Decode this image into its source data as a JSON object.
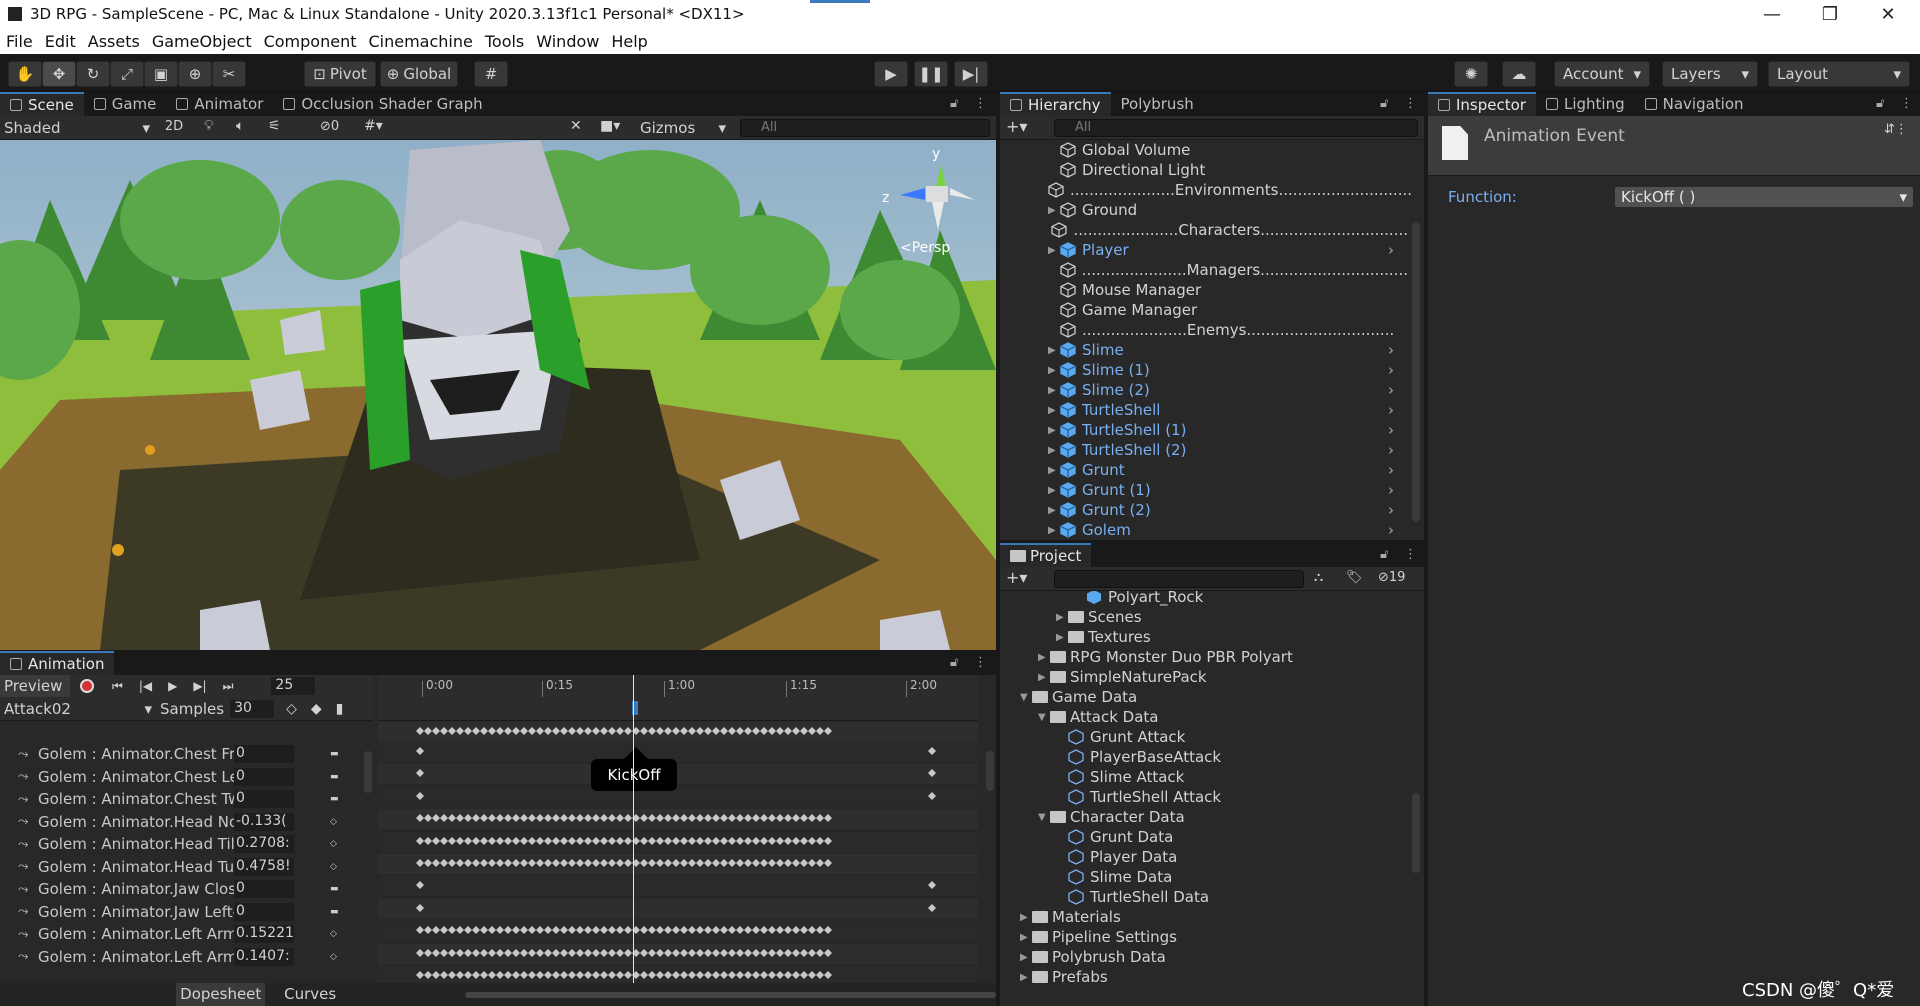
{
  "window": {
    "title": "3D RPG - SampleScene - PC, Mac & Linux Standalone - Unity 2020.3.13f1c1 Personal* <DX11>",
    "minimize": "—",
    "maximize": "❐",
    "close": "✕"
  },
  "menu": [
    "File",
    "Edit",
    "Assets",
    "GameObject",
    "Component",
    "Cinemachine",
    "Tools",
    "Window",
    "Help"
  ],
  "toolbar": {
    "pivot": "Pivot",
    "global": "Global",
    "account": "Account",
    "layers": "Layers",
    "layout": "Layout",
    "play": "▶",
    "pause": "❚❚",
    "step": "▶|"
  },
  "scene": {
    "tabs": [
      "Scene",
      "Game",
      "Animator",
      "Occlusion Shader Graph"
    ],
    "shading": "Shaded",
    "mode2d": "2D",
    "gizmos": "Gizmos",
    "search_placeholder": "All",
    "persp": "<Persp",
    "axis_y": "y",
    "axis_z": "z",
    "hidden_count": "0"
  },
  "animation": {
    "tab": "Animation",
    "preview": "Preview",
    "frame": "25",
    "clip": "Attack02",
    "samples_label": "Samples",
    "samples": "30",
    "ruler": [
      "0:00",
      "0:15",
      "1:00",
      "1:15",
      "2:00"
    ],
    "event_tooltip": "KickOff",
    "bottom_tabs": [
      "Dopesheet",
      "Curves"
    ],
    "properties": [
      {
        "name": "Golem : Animator.Chest Frc",
        "value": "0"
      },
      {
        "name": "Golem : Animator.Chest Lef",
        "value": "0"
      },
      {
        "name": "Golem : Animator.Chest Tw",
        "value": "0"
      },
      {
        "name": "Golem : Animator.Head Noc",
        "value": "-0.133("
      },
      {
        "name": "Golem : Animator.Head Tilt",
        "value": "0.2708:"
      },
      {
        "name": "Golem : Animator.Head Tur",
        "value": "0.4758!"
      },
      {
        "name": "Golem : Animator.Jaw Clos",
        "value": "0"
      },
      {
        "name": "Golem : Animator.Jaw Left-",
        "value": "0"
      },
      {
        "name": "Golem : Animator.Left Arm I",
        "value": "0.15221"
      },
      {
        "name": "Golem : Animator.Left Arm I",
        "value": "0.1407:"
      }
    ]
  },
  "hierarchy": {
    "tabs": [
      "Hierarchy",
      "Polybrush"
    ],
    "search_placeholder": "All",
    "items": [
      {
        "label": "Global Volume",
        "prefab": false,
        "arrow": false
      },
      {
        "label": "Directional Light",
        "prefab": false,
        "arrow": false
      },
      {
        "label": "......................Environments...............................",
        "prefab": false,
        "arrow": false
      },
      {
        "label": "Ground",
        "prefab": false,
        "arrow": true
      },
      {
        "label": "......................Characters...............................",
        "prefab": false,
        "arrow": false
      },
      {
        "label": "Player",
        "prefab": true,
        "arrow": true
      },
      {
        "label": "......................Managers...............................",
        "prefab": false,
        "arrow": false
      },
      {
        "label": "Mouse Manager",
        "prefab": false,
        "arrow": false
      },
      {
        "label": "Game Manager",
        "prefab": false,
        "arrow": false
      },
      {
        "label": "......................Enemys...............................",
        "prefab": false,
        "arrow": false
      },
      {
        "label": "Slime",
        "prefab": true,
        "arrow": true
      },
      {
        "label": "Slime (1)",
        "prefab": true,
        "arrow": true
      },
      {
        "label": "Slime (2)",
        "prefab": true,
        "arrow": true
      },
      {
        "label": "TurtleShell",
        "prefab": true,
        "arrow": true
      },
      {
        "label": "TurtleShell (1)",
        "prefab": true,
        "arrow": true
      },
      {
        "label": "TurtleShell (2)",
        "prefab": true,
        "arrow": true
      },
      {
        "label": "Grunt",
        "prefab": true,
        "arrow": true
      },
      {
        "label": "Grunt (1)",
        "prefab": true,
        "arrow": true
      },
      {
        "label": "Grunt (2)",
        "prefab": true,
        "arrow": true
      },
      {
        "label": "Golem",
        "prefab": true,
        "arrow": true
      }
    ]
  },
  "project": {
    "tab": "Project",
    "hidden_count": "19",
    "items": [
      {
        "label": "Polyart_Rock",
        "depth": 3,
        "type": "prefab",
        "arrow": ""
      },
      {
        "label": "Scenes",
        "depth": 2,
        "type": "folder",
        "arrow": "▶"
      },
      {
        "label": "Textures",
        "depth": 2,
        "type": "folder",
        "arrow": "▶"
      },
      {
        "label": "RPG Monster Duo PBR Polyart",
        "depth": 1,
        "type": "folder",
        "arrow": "▶"
      },
      {
        "label": "SimpleNaturePack",
        "depth": 1,
        "type": "folder",
        "arrow": "▶"
      },
      {
        "label": "Game Data",
        "depth": 0,
        "type": "folder",
        "arrow": "▼"
      },
      {
        "label": "Attack Data",
        "depth": 1,
        "type": "folder",
        "arrow": "▼"
      },
      {
        "label": "Grunt Attack",
        "depth": 2,
        "type": "asset",
        "arrow": ""
      },
      {
        "label": "PlayerBaseAttack",
        "depth": 2,
        "type": "asset",
        "arrow": ""
      },
      {
        "label": "Slime Attack",
        "depth": 2,
        "type": "asset",
        "arrow": ""
      },
      {
        "label": "TurtleShell Attack",
        "depth": 2,
        "type": "asset",
        "arrow": ""
      },
      {
        "label": "Character Data",
        "depth": 1,
        "type": "folder",
        "arrow": "▼"
      },
      {
        "label": "Grunt Data",
        "depth": 2,
        "type": "asset",
        "arrow": ""
      },
      {
        "label": "Player Data",
        "depth": 2,
        "type": "asset",
        "arrow": ""
      },
      {
        "label": "Slime Data",
        "depth": 2,
        "type": "asset",
        "arrow": ""
      },
      {
        "label": "TurtleShell Data",
        "depth": 2,
        "type": "asset",
        "arrow": ""
      },
      {
        "label": "Materials",
        "depth": 0,
        "type": "folder",
        "arrow": "▶"
      },
      {
        "label": "Pipeline Settings",
        "depth": 0,
        "type": "folder",
        "arrow": "▶"
      },
      {
        "label": "Polybrush Data",
        "depth": 0,
        "type": "folder",
        "arrow": "▶"
      },
      {
        "label": "Prefabs",
        "depth": 0,
        "type": "folder",
        "arrow": "▶"
      }
    ]
  },
  "inspector": {
    "tabs": [
      "Inspector",
      "Lighting",
      "Navigation"
    ],
    "header": "Animation Event",
    "function_label": "Function:",
    "function_value": "KickOff ( )"
  },
  "watermark": "CSDN @傻゜Q*爱"
}
